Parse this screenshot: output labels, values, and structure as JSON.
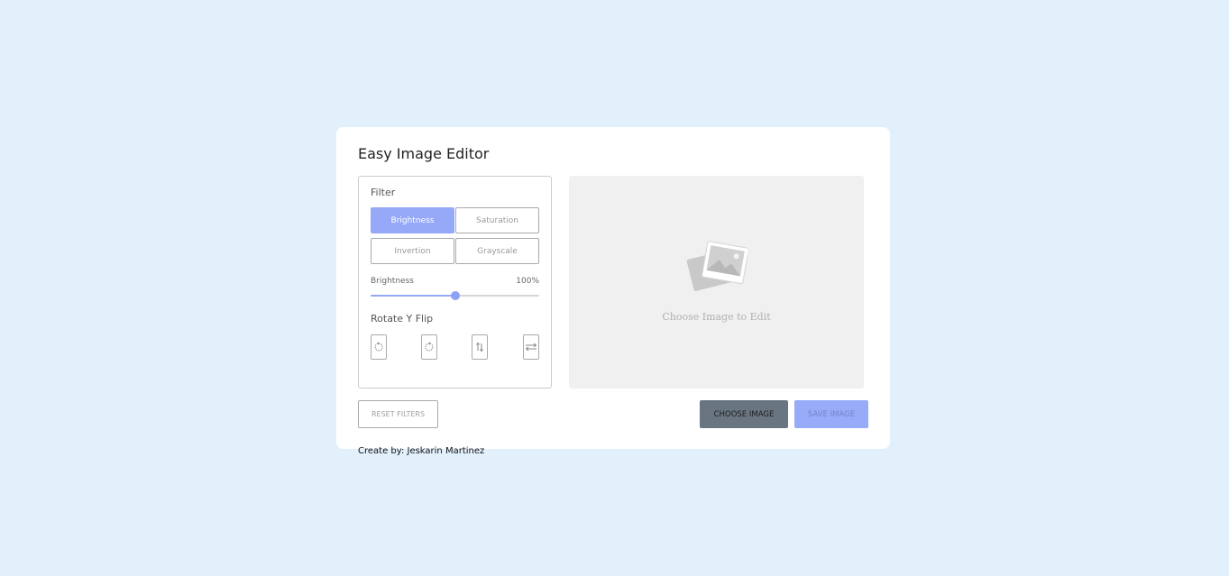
{
  "app": {
    "title": "Easy Image Editor"
  },
  "filter": {
    "label": "Filter",
    "options": [
      "Brightness",
      "Saturation",
      "Invertion",
      "Grayscale"
    ],
    "active": "Brightness"
  },
  "slider": {
    "label": "Brightness",
    "value_text": "100%",
    "value_fraction": 0.5
  },
  "rotate": {
    "label": "Rotate Y Flip",
    "buttons": [
      {
        "icon": "rotate-left-icon"
      },
      {
        "icon": "rotate-right-icon"
      },
      {
        "icon": "flip-vertical-icon"
      },
      {
        "icon": "flip-horizontal-icon"
      }
    ]
  },
  "preview": {
    "placeholder_text": "Choose Image to Edit",
    "icon": "image-placeholder-icon"
  },
  "actions": {
    "reset_label": "RESET FILTERS",
    "choose_label": "CHOOSE IMAGE",
    "save_label": "SAVE IMAGE"
  },
  "footer": {
    "credit": "Create by: Jeskarin Martinez"
  },
  "colors": {
    "background": "#e2f0fc",
    "accent": "#96a9f8",
    "choose_button": "#697580"
  }
}
